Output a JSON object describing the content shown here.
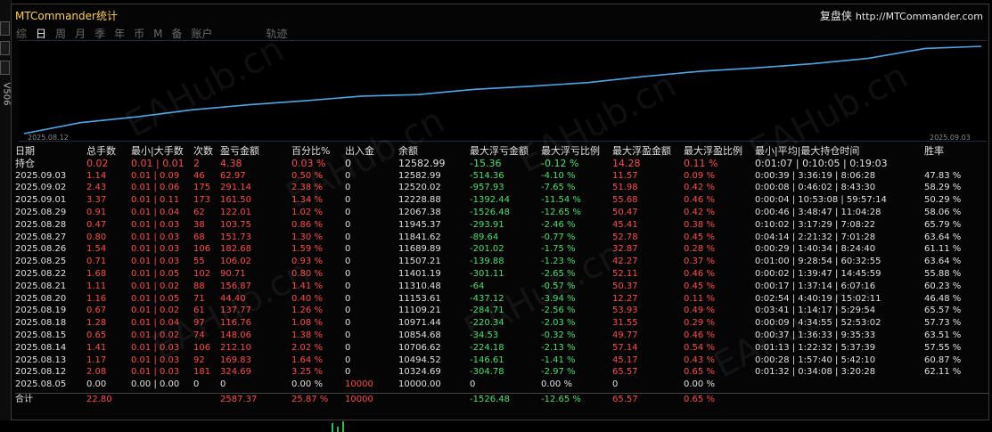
{
  "window": {
    "title": "MTCommander统计",
    "brand_cn": "复盘侠",
    "brand_url": "http://MTCommander.com",
    "side_label": "V506"
  },
  "tabs": [
    {
      "label": "综",
      "active": false
    },
    {
      "label": "日",
      "active": true
    },
    {
      "label": "周",
      "active": false
    },
    {
      "label": "月",
      "active": false
    },
    {
      "label": "季",
      "active": false
    },
    {
      "label": "年",
      "active": false
    },
    {
      "label": "币",
      "active": false
    },
    {
      "label": "M",
      "active": false
    },
    {
      "label": "备",
      "active": false
    },
    {
      "label": "账户",
      "active": false
    },
    {
      "label": "轨迹",
      "active": false
    }
  ],
  "chart_data": {
    "type": "line",
    "x_start": "2025.08.12",
    "x_end": "2025.09.03",
    "line_color": "#4aa8e8",
    "values": [
      10000,
      10324.69,
      10494.52,
      10706.62,
      10854.68,
      10971.44,
      11109.21,
      11153.61,
      11310.48,
      11401.19,
      11507.21,
      11689.89,
      11841.62,
      11945.37,
      12067.38,
      12228.88,
      12520.02,
      12582.99
    ]
  },
  "columns": [
    "日期",
    "总手数",
    "最小|大手数",
    "次数",
    "盈亏金额",
    "百分比%",
    "出入金",
    "余额",
    "最大浮亏金额",
    "最大浮亏比例",
    "最大浮盈金额",
    "最大浮盈比例",
    "最小|平均|最大持仓时间",
    "胜率"
  ],
  "holding": {
    "label": "持仓",
    "cells": [
      "0.02",
      "0.01 | 0.01",
      "2",
      "4.38",
      "0.03 %",
      "0",
      "12582.99",
      "-15.36",
      "-0.12 %",
      "14.28",
      "0.11 %",
      "0:01:07 | 0:10:05 | 0:19:03",
      ""
    ]
  },
  "rows": [
    [
      "2025.09.03",
      "1.14",
      "0.01 | 0.09",
      "46",
      "62.97",
      "0.50 %",
      "0",
      "12582.99",
      "-514.36",
      "-4.10 %",
      "11.57",
      "0.09 %",
      "0:00:39 | 3:36:19 | 8:06:28",
      "47.83 %"
    ],
    [
      "2025.09.02",
      "2.43",
      "0.01 | 0.06",
      "175",
      "291.14",
      "2.38 %",
      "0",
      "12520.02",
      "-957.93",
      "-7.65 %",
      "51.98",
      "0.42 %",
      "0:00:08 | 0:46:02 | 8:43:30",
      "58.29 %"
    ],
    [
      "2025.09.01",
      "3.37",
      "0.01 | 0.11",
      "173",
      "161.50",
      "1.34 %",
      "0",
      "12228.88",
      "-1392.44",
      "-11.54 %",
      "55.68",
      "0.46 %",
      "0:00:04 | 10:53:08 | 59:57:14",
      "50.29 %"
    ],
    [
      "2025.08.29",
      "0.91",
      "0.01 | 0.04",
      "62",
      "122.01",
      "1.02 %",
      "0",
      "12067.38",
      "-1526.48",
      "-12.65 %",
      "50.47",
      "0.42 %",
      "0:00:46 | 3:48:47 | 11:04:28",
      "58.06 %"
    ],
    [
      "2025.08.28",
      "0.47",
      "0.01 | 0.03",
      "38",
      "103.75",
      "0.86 %",
      "0",
      "11945.37",
      "-293.91",
      "-2.46 %",
      "45.41",
      "0.38 %",
      "0:10:02 | 3:17:29 | 7:08:22",
      "65.79 %"
    ],
    [
      "2025.08.27",
      "0.80",
      "0.01 | 0.03",
      "68",
      "151.73",
      "1.30 %",
      "0",
      "11841.62",
      "-89.64",
      "-0.77 %",
      "52.78",
      "0.45 %",
      "0:04:14 | 2:21:32 | 7:01:28",
      "63.64 %"
    ],
    [
      "2025.08.26",
      "1.54",
      "0.01 | 0.03",
      "106",
      "182.68",
      "1.59 %",
      "0",
      "11689.89",
      "-201.02",
      "-1.75 %",
      "32.87",
      "0.28 %",
      "0:00:29 | 1:40:34 | 8:24:40",
      "61.11 %"
    ],
    [
      "2025.08.25",
      "0.71",
      "0.01 | 0.03",
      "55",
      "106.02",
      "0.93 %",
      "0",
      "11507.21",
      "-139.88",
      "-1.23 %",
      "42.27",
      "0.37 %",
      "0:01:00 | 9:28:54 | 60:32:55",
      "63.64 %"
    ],
    [
      "2025.08.22",
      "1.68",
      "0.01 | 0.05",
      "102",
      "90.71",
      "0.80 %",
      "0",
      "11401.19",
      "-301.11",
      "-2.65 %",
      "52.11",
      "0.46 %",
      "0:00:02 | 1:39:47 | 14:45:59",
      "55.88 %"
    ],
    [
      "2025.08.21",
      "1.11",
      "0.01 | 0.02",
      "88",
      "156.87",
      "1.41 %",
      "0",
      "11310.48",
      "-64",
      "-0.57 %",
      "50.37",
      "0.45 %",
      "0:00:17 | 1:37:14 | 6:07:16",
      "60.23 %"
    ],
    [
      "2025.08.20",
      "1.16",
      "0.01 | 0.05",
      "71",
      "44.40",
      "0.40 %",
      "0",
      "11153.61",
      "-437.12",
      "-3.94 %",
      "12.27",
      "0.11 %",
      "0:02:54 | 4:40:19 | 15:02:11",
      "46.48 %"
    ],
    [
      "2025.08.19",
      "0.67",
      "0.01 | 0.02",
      "61",
      "137.77",
      "1.26 %",
      "0",
      "11109.21",
      "-284.71",
      "-2.56 %",
      "53.93",
      "0.49 %",
      "0:03:41 | 1:14:17 | 5:29:54",
      "65.57 %"
    ],
    [
      "2025.08.18",
      "1.28",
      "0.01 | 0.04",
      "97",
      "116.76",
      "1.08 %",
      "0",
      "10971.44",
      "-220.34",
      "-2.03 %",
      "31.55",
      "0.29 %",
      "0:00:09 | 4:34:55 | 52:53:02",
      "57.73 %"
    ],
    [
      "2025.08.15",
      "0.65",
      "0.01 | 0.02",
      "74",
      "148.06",
      "1.38 %",
      "0",
      "10854.68",
      "-34.53",
      "-0.32 %",
      "49.77",
      "0.46 %",
      "0:00:37 | 1:36:33 | 9:35:33",
      "63.51 %"
    ],
    [
      "2025.08.14",
      "1.41",
      "0.01 | 0.03",
      "106",
      "212.10",
      "2.02 %",
      "0",
      "10706.62",
      "-224.18",
      "-2.13 %",
      "57.14",
      "0.54 %",
      "0:01:13 | 1:22:32 | 5:37:39",
      "57.55 %"
    ],
    [
      "2025.08.13",
      "1.17",
      "0.01 | 0.03",
      "92",
      "169.83",
      "1.64 %",
      "0",
      "10494.52",
      "-146.61",
      "-1.41 %",
      "45.17",
      "0.43 %",
      "0:00:28 | 1:57:40 | 5:42:10",
      "60.87 %"
    ],
    [
      "2025.08.12",
      "2.08",
      "0.01 | 0.03",
      "181",
      "324.69",
      "3.25 %",
      "0",
      "10324.69",
      "-304.78",
      "-2.97 %",
      "65.57",
      "0.65 %",
      "0:01:32 | 0:34:08 | 3:20:28",
      "62.11 %"
    ],
    [
      "2025.08.05",
      "0.00",
      "0.00 | 0.00",
      "0",
      "0",
      "0.00 %",
      "10000",
      "10000.00",
      "0",
      "0.00 %",
      "0",
      "0.00 %",
      "",
      ""
    ]
  ],
  "total": {
    "label": "合计",
    "cells": [
      "22.80",
      "",
      "",
      "2587.37",
      "25.87 %",
      "10000",
      "",
      "-1526.48",
      "-12.65 %",
      "65.57",
      "0.65 %",
      "",
      ""
    ]
  },
  "watermark": "EAHub.cn"
}
